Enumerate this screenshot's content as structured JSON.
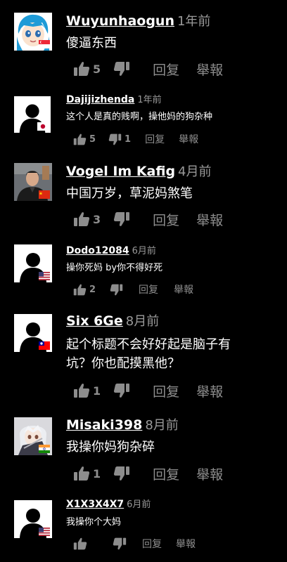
{
  "comments": [
    {
      "user": "Wuyunhaogun",
      "time": "1年前",
      "text": "傻逼东西",
      "likes": "5",
      "reply": "回复",
      "report": "舉報",
      "avatar_icon": "anime-avatar-icon",
      "flag": "singapore-flag-icon"
    },
    {
      "user": "Dajijizhenda",
      "time": "1年前",
      "text": "这个人是真的贱啊，操他妈的狗杂种",
      "likes": "5",
      "dislikes": "1",
      "reply": "回复",
      "report": "舉報",
      "avatar_icon": "default-person-icon",
      "flag": "japan-flag-icon"
    },
    {
      "user": "Vogel Im Kafig",
      "time": "4月前",
      "text": "中国万岁，草泥妈煞笔",
      "likes": "3",
      "reply": "回复",
      "report": "舉報",
      "avatar_icon": "photo-avatar-icon",
      "flag": "china-flag-icon"
    },
    {
      "user": "Dodo12084",
      "time": "6月前",
      "text": "操你死妈 by你不得好死",
      "likes": "2",
      "reply": "回复",
      "report": "舉報",
      "avatar_icon": "default-person-icon",
      "flag": "usa-flag-icon"
    },
    {
      "user": "Six 6Ge",
      "time": "8月前",
      "text_line1": "起个标题不会好好起是脑子有",
      "text_line2": "坑？你也配摸黑他？",
      "likes": "1",
      "reply": "回复",
      "report": "舉報",
      "avatar_icon": "default-person-icon",
      "flag": "taiwan-flag-icon"
    },
    {
      "user": "Misaki398",
      "time": "8月前",
      "text": "我操你妈狗杂碎",
      "likes": "1",
      "reply": "回复",
      "report": "舉報",
      "avatar_icon": "anime-girl-avatar-icon",
      "flag": "india-flag-icon"
    },
    {
      "user": "X1X3X4X7",
      "time": "6月前",
      "text": "我操你个大妈",
      "reply": "回复",
      "report": "舉報",
      "avatar_icon": "default-person-icon",
      "flag": "usa-flag-icon"
    }
  ],
  "colors": {
    "background": "#000000",
    "secondary_text": "#8d8d8d"
  }
}
